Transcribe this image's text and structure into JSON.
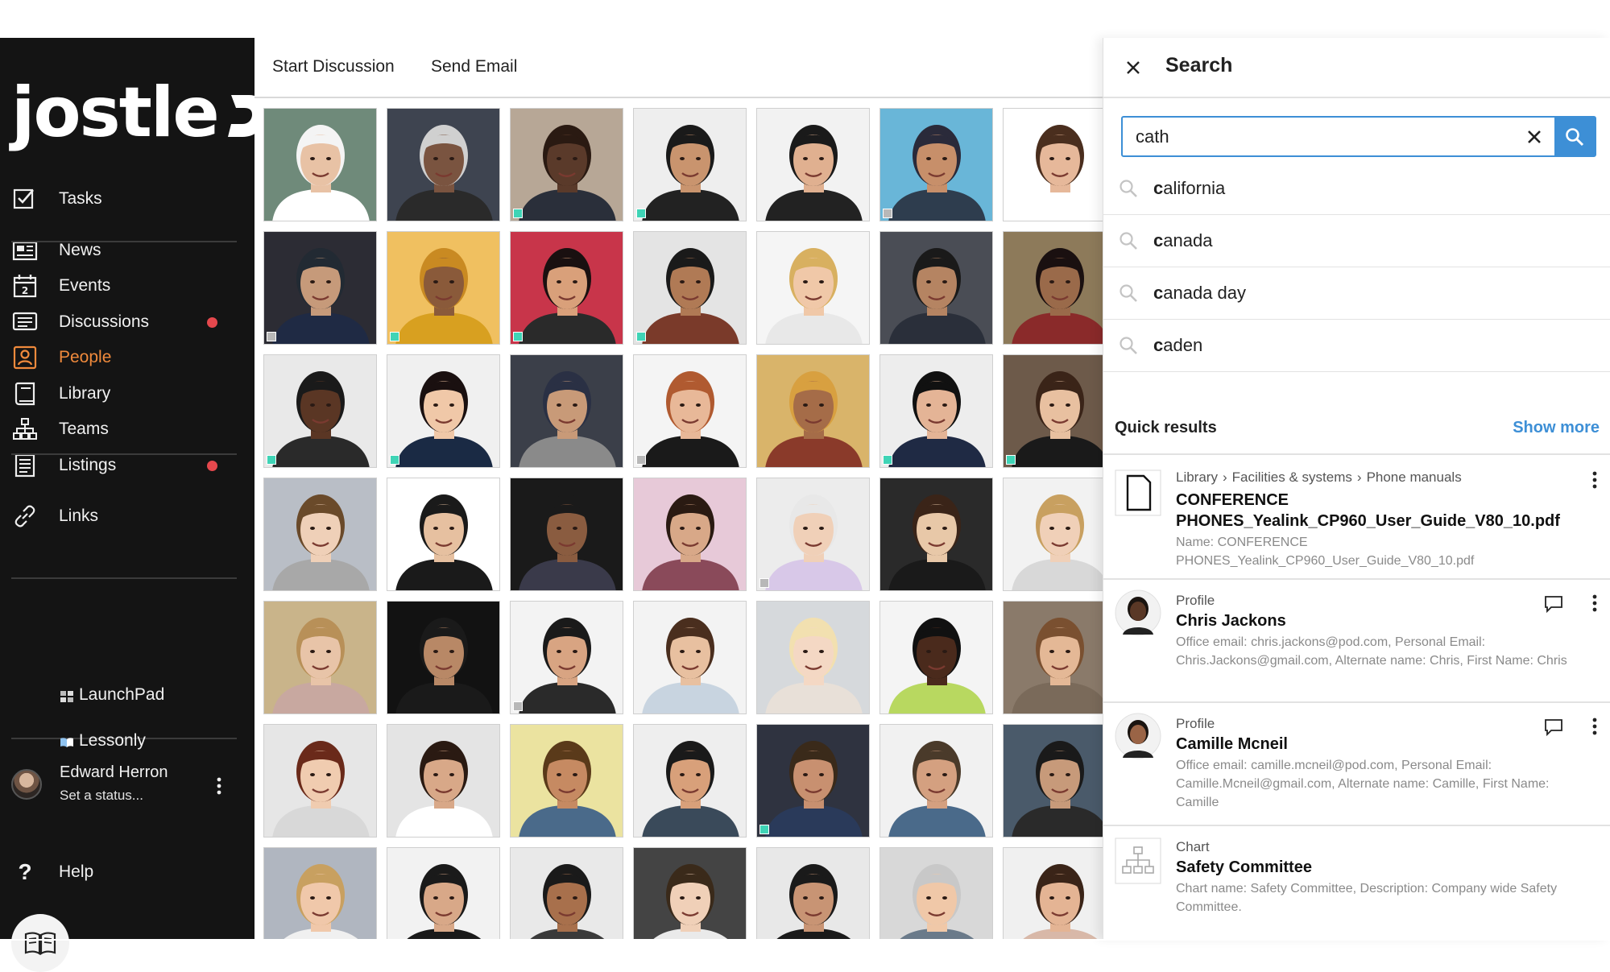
{
  "sidebar": {
    "logo_text": "jostle",
    "nav": [
      {
        "label": "Tasks",
        "icon": "tasks-icon",
        "badge": false,
        "active": false
      },
      {
        "label": "News",
        "icon": "news-icon",
        "badge": false,
        "active": false
      },
      {
        "label": "Events",
        "icon": "calendar-icon",
        "badge": false,
        "active": false
      },
      {
        "label": "Discussions",
        "icon": "discussions-icon",
        "badge": true,
        "active": false
      },
      {
        "label": "People",
        "icon": "people-icon",
        "badge": false,
        "active": true
      },
      {
        "label": "Library",
        "icon": "library-icon",
        "badge": false,
        "active": false
      },
      {
        "label": "Teams",
        "icon": "teams-icon",
        "badge": false,
        "active": false
      },
      {
        "label": "Listings",
        "icon": "listings-icon",
        "badge": true,
        "active": false
      },
      {
        "label": "Links",
        "icon": "link-icon",
        "badge": false,
        "active": false
      }
    ],
    "links": [
      {
        "label": "LaunchPad",
        "icon": "launchpad-icon"
      },
      {
        "label": "Lessonly",
        "icon": "book-icon"
      }
    ],
    "user": {
      "name": "Edward Herron",
      "status": "Set a status..."
    },
    "help_label": "Help",
    "accent": "#f08a3c",
    "badge_color": "#e5484d"
  },
  "toolbar": {
    "start_discussion": "Start Discussion",
    "send_email": "Send Email"
  },
  "people_grid": {
    "rows": 7,
    "cols": 7,
    "presence": [
      [
        "none",
        "none",
        "on",
        "on",
        "none",
        "off",
        "none"
      ],
      [
        "off",
        "on",
        "on",
        "on",
        "none",
        "none",
        "none"
      ],
      [
        "on",
        "on",
        "none",
        "off",
        "none",
        "on",
        "on"
      ],
      [
        "none",
        "none",
        "none",
        "none",
        "off",
        "none",
        "none"
      ],
      [
        "none",
        "none",
        "off",
        "none",
        "none",
        "none",
        "none"
      ],
      [
        "none",
        "none",
        "none",
        "none",
        "on",
        "none",
        "none"
      ],
      [
        "none",
        "none",
        "none",
        "none",
        "none",
        "none",
        "none"
      ]
    ]
  },
  "search": {
    "title": "Search",
    "query": "cath",
    "suggestions": [
      {
        "match": "c",
        "rest": "alifornia"
      },
      {
        "match": "c",
        "rest": "anada"
      },
      {
        "match": "c",
        "rest": "anada day"
      },
      {
        "match": "c",
        "rest": "aden"
      }
    ],
    "quick_results_label": "Quick results",
    "show_more_label": "Show more",
    "accent": "#3d8fd6",
    "results": [
      {
        "type": "file",
        "breadcrumb": [
          "Library",
          "Facilities & systems",
          "Phone manuals"
        ],
        "title": "CONFERENCE PHONES_Yealink_CP960_User_Guide_V80_10.pdf",
        "detail": "Name: CONFERENCE PHONES_Yealink_CP960_User_Guide_V80_10.pdf"
      },
      {
        "type": "profile",
        "kind": "Profile",
        "title": "Chris Jackons",
        "detail": "Office email: chris.jackons@pod.com, Personal Email: Chris.Jackons@gmail.com, Alternate name: Chris, First Name: Chris"
      },
      {
        "type": "profile",
        "kind": "Profile",
        "title": "Camille Mcneil",
        "detail": "Office email: camille.mcneil@pod.com, Personal Email: Camille.Mcneil@gmail.com, Alternate name: Camille, First Name: Camille"
      },
      {
        "type": "chart",
        "kind": "Chart",
        "title": "Safety Committee",
        "detail": "Chart name: Safety Committee, Description: Company wide Safety Committee."
      }
    ]
  }
}
